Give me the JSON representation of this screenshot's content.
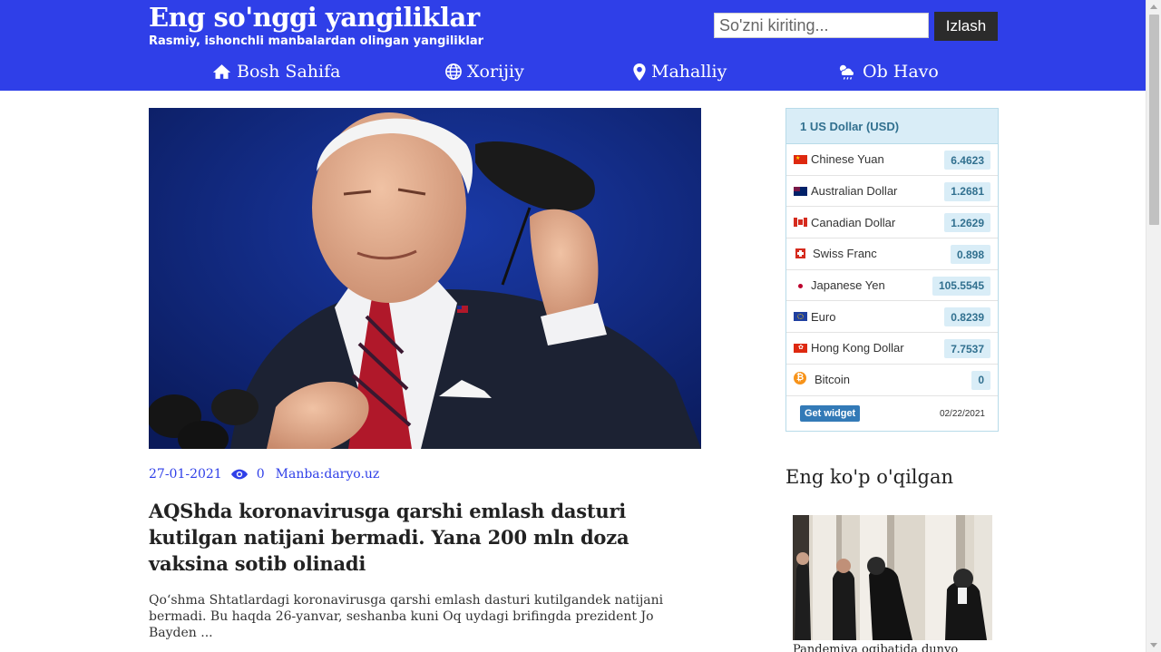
{
  "header": {
    "title": "Eng so'nggi yangiliklar",
    "tagline": "Rasmiy, ishonchli manbalardan olingan yangiliklar",
    "search_placeholder": "So'zni kiriting...",
    "search_button": "Izlash",
    "background_color": "#2f3fe8",
    "nav": [
      {
        "label": "Bosh Sahifa",
        "icon": "home-icon"
      },
      {
        "label": "Xorijiy",
        "icon": "globe-icon"
      },
      {
        "label": "Mahalliy",
        "icon": "map-marker-icon"
      },
      {
        "label": "Ob Havo",
        "icon": "weather-icon"
      }
    ]
  },
  "article": {
    "date": "27-01-2021",
    "views": "0",
    "source": "Manba:daryo.uz",
    "headline": "AQShda koronavirusga qarshi emlash dasturi kutilgan natijani bermadi. Yana 200 mln doza vaksina sotib olinadi",
    "excerpt": "Qo‘shma Shtatlardagi koronavirusga qarshi emlash dasturi kutilgandek natijani bermadi. Bu haqda 26-yanvar, seshanba kuni Oq uydagi brifingda prezident Jo Bayden ..."
  },
  "currency_widget": {
    "header": "1 US Dollar (USD)",
    "rows": [
      {
        "name": "Chinese Yuan",
        "value": "6.4623",
        "flag": "cn"
      },
      {
        "name": "Australian Dollar",
        "value": "1.2681",
        "flag": "au"
      },
      {
        "name": "Canadian Dollar",
        "value": "1.2629",
        "flag": "ca"
      },
      {
        "name": "Swiss Franc",
        "value": "0.898",
        "flag": "ch"
      },
      {
        "name": "Japanese Yen",
        "value": "105.5545",
        "flag": "jp"
      },
      {
        "name": "Euro",
        "value": "0.8239",
        "flag": "eu"
      },
      {
        "name": "Hong Kong Dollar",
        "value": "7.7537",
        "flag": "hk"
      },
      {
        "name": "Bitcoin",
        "value": "0",
        "flag": "btc"
      }
    ],
    "get_widget": "Get widget",
    "date": "02/22/2021"
  },
  "most_read": {
    "title": "Eng ko'p o'qilgan",
    "first_caption": "Pandemiya oqibatida dunyo"
  }
}
